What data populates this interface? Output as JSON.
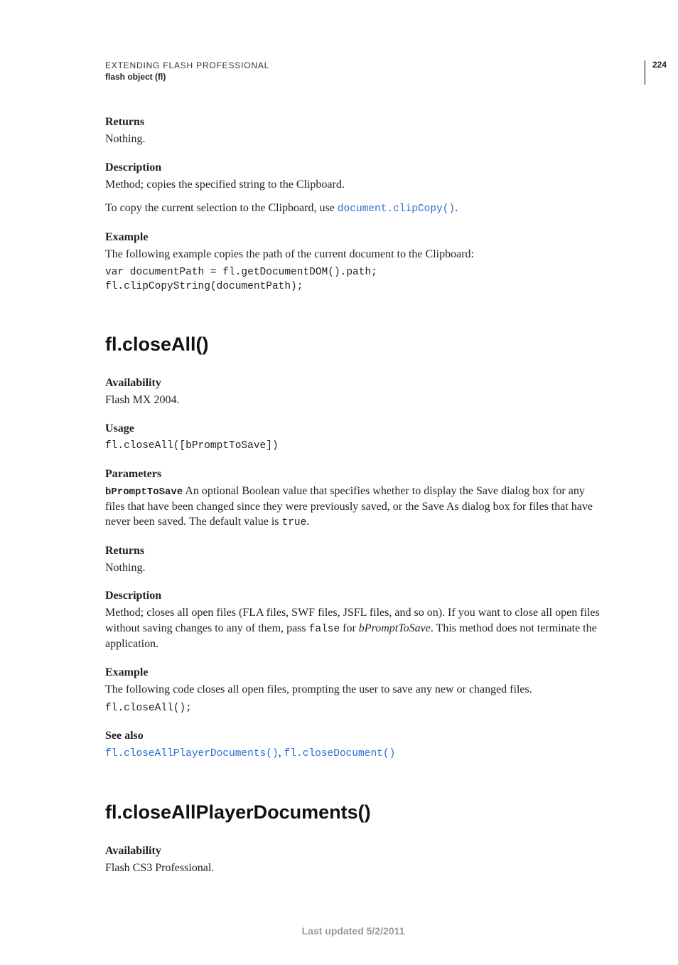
{
  "header": {
    "title": "EXTENDING FLASH PROFESSIONAL",
    "subtitle": "flash object (fl)",
    "page_number": "224"
  },
  "sec1": {
    "returns_h": "Returns",
    "returns_body": "Nothing.",
    "desc_h": "Description",
    "desc_body": "Method; copies the specified string to the Clipboard.",
    "desc2_pre": "To copy the current selection to the Clipboard, use ",
    "desc2_link": "document.clipCopy()",
    "desc2_post": ".",
    "example_h": "Example",
    "example_body": "The following example copies the path of the current document to the Clipboard:",
    "example_code": "var documentPath = fl.getDocumentDOM().path;\nfl.clipCopyString(documentPath);"
  },
  "sec2": {
    "title": "fl.closeAll()",
    "avail_h": "Availability",
    "avail_body": "Flash MX 2004.",
    "usage_h": "Usage",
    "usage_code": "fl.closeAll([bPromptToSave])",
    "params_h": "Parameters",
    "param_name": "bPromptToSave",
    "param_body_a": "  An optional Boolean value that specifies whether to display the Save dialog box for any files that have been changed since they were previously saved, or the Save As dialog box for files that have never been saved. The default value is ",
    "param_body_code": "true",
    "param_body_end": ".",
    "returns_h": "Returns",
    "returns_body": "Nothing.",
    "desc_h": "Description",
    "desc_body_a": "Method; closes all open files (FLA files, SWF files, JSFL files, and so on). If you want to close all open files without saving changes to any of them, pass ",
    "desc_body_code": "false",
    "desc_body_b": " for ",
    "desc_body_i": "bPromptToSave",
    "desc_body_c": ". This method does not terminate the application.",
    "example_h": "Example",
    "example_body": "The following code closes all open files, prompting the user to save any new or changed files.",
    "example_code": "fl.closeAll();",
    "seealso_h": "See also",
    "seealso_link1": "fl.closeAllPlayerDocuments()",
    "seealso_sep": ", ",
    "seealso_link2": "fl.closeDocument()"
  },
  "sec3": {
    "title": "fl.closeAllPlayerDocuments()",
    "avail_h": "Availability",
    "avail_body": "Flash CS3 Professional."
  },
  "footer": "Last updated 5/2/2011"
}
